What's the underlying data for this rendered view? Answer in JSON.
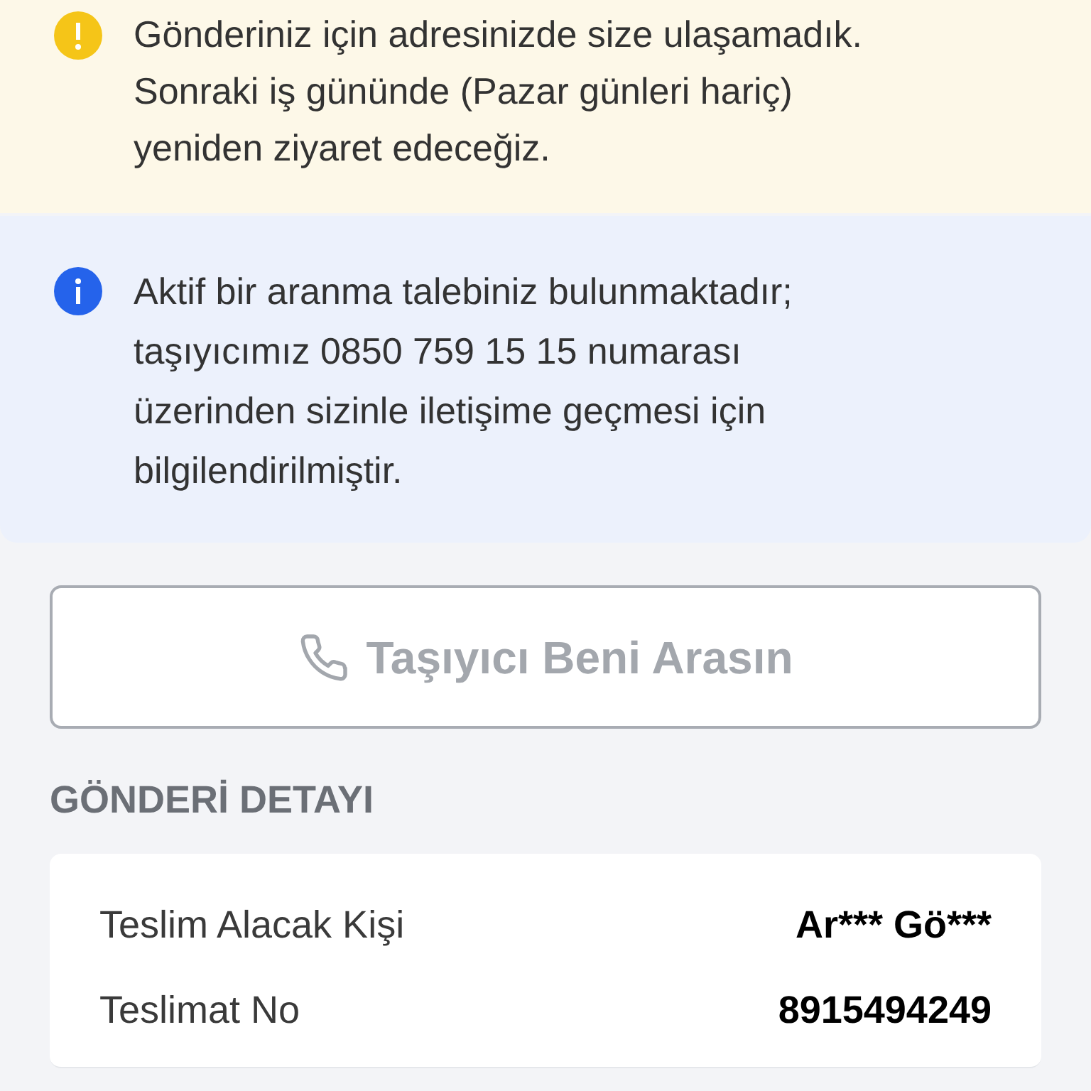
{
  "warning_notice": {
    "lines": [
      "Gönderiniz için adresinizde size ulaşamadık.",
      "Sonraki iş gününde (Pazar günleri hariç)",
      "yeniden ziyaret edeceğiz."
    ]
  },
  "info_notice": {
    "lines": [
      "Aktif bir aranma talebiniz bulunmaktadır;",
      "taşıyıcımız 0850 759 15 15 numarası",
      "üzerinden sizinle iletişime geçmesi için",
      "bilgilendirilmiştir."
    ]
  },
  "call_button": {
    "label": "Taşıyıcı Beni Arasın",
    "disabled": true
  },
  "section_title": "GÖNDERİ DETAYI",
  "details": [
    {
      "label": "Teslim Alacak Kişi",
      "value": "Ar*** Gö***"
    },
    {
      "label": "Teslimat No",
      "value": "8915494249"
    }
  ]
}
